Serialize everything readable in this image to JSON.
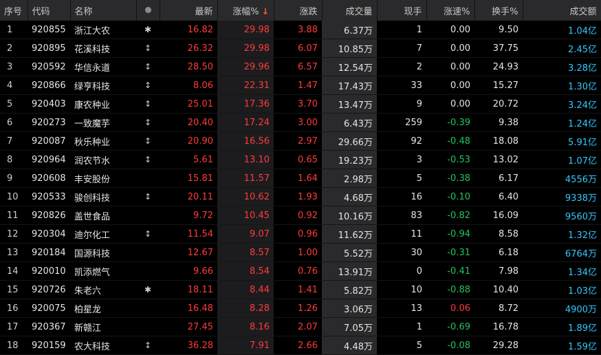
{
  "headers": {
    "seq": "序号",
    "code": "代码",
    "name": "名称",
    "flag": "",
    "latest": "最新",
    "change_pct": "涨幅%",
    "sort_arrow": "↓",
    "change": "涨跌",
    "volume": "成交量",
    "current": "现手",
    "speed": "涨速%",
    "turnover": "换手%",
    "amount": "成交额"
  },
  "colors": {
    "up": "#ff3b3b",
    "down": "#22c55e",
    "neutral": "#e6e6e6",
    "amount": "#33c9ff",
    "sort_arrow": "#ff5a1f"
  },
  "rows": [
    {
      "seq": "1",
      "code": "920855",
      "name": "浙江大农",
      "flag": "✱",
      "latest": "16.82",
      "change_pct": "29.98",
      "change": "3.88",
      "volume": "6.37万",
      "current": "1",
      "speed": "0.00",
      "speed_dir": "neutral",
      "turnover": "9.50",
      "amount": "1.04亿"
    },
    {
      "seq": "2",
      "code": "920895",
      "name": "花溪科技",
      "flag": "↕",
      "latest": "26.32",
      "change_pct": "29.98",
      "change": "6.07",
      "volume": "10.85万",
      "current": "7",
      "speed": "0.00",
      "speed_dir": "neutral",
      "turnover": "37.75",
      "amount": "2.45亿"
    },
    {
      "seq": "3",
      "code": "920592",
      "name": "华信永道",
      "flag": "↕",
      "latest": "28.50",
      "change_pct": "29.96",
      "change": "6.57",
      "volume": "12.54万",
      "current": "2",
      "speed": "0.00",
      "speed_dir": "neutral",
      "turnover": "24.93",
      "amount": "3.28亿"
    },
    {
      "seq": "4",
      "code": "920866",
      "name": "绿亨科技",
      "flag": "↕",
      "latest": "8.06",
      "change_pct": "22.31",
      "change": "1.47",
      "volume": "17.43万",
      "current": "33",
      "speed": "0.00",
      "speed_dir": "neutral",
      "turnover": "15.27",
      "amount": "1.30亿"
    },
    {
      "seq": "5",
      "code": "920403",
      "name": "康农种业",
      "flag": "↕",
      "latest": "25.01",
      "change_pct": "17.36",
      "change": "3.70",
      "volume": "13.47万",
      "current": "9",
      "speed": "0.00",
      "speed_dir": "neutral",
      "turnover": "20.72",
      "amount": "3.24亿"
    },
    {
      "seq": "6",
      "code": "920273",
      "name": "一致魔芋",
      "flag": "↕",
      "latest": "20.40",
      "change_pct": "17.24",
      "change": "3.00",
      "volume": "6.43万",
      "current": "259",
      "speed": "-0.39",
      "speed_dir": "down",
      "turnover": "9.38",
      "amount": "1.24亿"
    },
    {
      "seq": "7",
      "code": "920087",
      "name": "秋乐种业",
      "flag": "↕",
      "latest": "20.90",
      "change_pct": "16.56",
      "change": "2.97",
      "volume": "29.66万",
      "current": "92",
      "speed": "-0.48",
      "speed_dir": "down",
      "turnover": "18.08",
      "amount": "5.91亿"
    },
    {
      "seq": "8",
      "code": "920964",
      "name": "润农节水",
      "flag": "↕",
      "latest": "5.61",
      "change_pct": "13.10",
      "change": "0.65",
      "volume": "19.23万",
      "current": "3",
      "speed": "-0.53",
      "speed_dir": "down",
      "turnover": "13.02",
      "amount": "1.07亿"
    },
    {
      "seq": "9",
      "code": "920608",
      "name": "丰安股份",
      "flag": "",
      "latest": "15.81",
      "change_pct": "11.57",
      "change": "1.64",
      "volume": "2.98万",
      "current": "5",
      "speed": "-0.38",
      "speed_dir": "down",
      "turnover": "6.17",
      "amount": "4556万"
    },
    {
      "seq": "10",
      "code": "920533",
      "name": "骏创科技",
      "flag": "↕",
      "latest": "20.11",
      "change_pct": "10.62",
      "change": "1.93",
      "volume": "4.68万",
      "current": "16",
      "speed": "-0.10",
      "speed_dir": "down",
      "turnover": "6.40",
      "amount": "9338万"
    },
    {
      "seq": "11",
      "code": "920826",
      "name": "盖世食品",
      "flag": "",
      "latest": "9.72",
      "change_pct": "10.45",
      "change": "0.92",
      "volume": "10.16万",
      "current": "83",
      "speed": "-0.82",
      "speed_dir": "down",
      "turnover": "16.09",
      "amount": "9560万"
    },
    {
      "seq": "12",
      "code": "920304",
      "name": "迪尔化工",
      "flag": "↕",
      "latest": "11.54",
      "change_pct": "9.07",
      "change": "0.96",
      "volume": "11.62万",
      "current": "11",
      "speed": "-0.94",
      "speed_dir": "down",
      "turnover": "8.58",
      "amount": "1.32亿"
    },
    {
      "seq": "13",
      "code": "920184",
      "name": "国源科技",
      "flag": "",
      "latest": "12.67",
      "change_pct": "8.57",
      "change": "1.00",
      "volume": "5.52万",
      "current": "30",
      "speed": "-0.31",
      "speed_dir": "down",
      "turnover": "6.18",
      "amount": "6764万"
    },
    {
      "seq": "14",
      "code": "920010",
      "name": "凯添燃气",
      "flag": "",
      "latest": "9.66",
      "change_pct": "8.54",
      "change": "0.76",
      "volume": "13.91万",
      "current": "0",
      "speed": "-0.41",
      "speed_dir": "down",
      "turnover": "7.98",
      "amount": "1.34亿"
    },
    {
      "seq": "15",
      "code": "920726",
      "name": "朱老六",
      "flag": "✱",
      "latest": "18.11",
      "change_pct": "8.44",
      "change": "1.41",
      "volume": "5.82万",
      "current": "10",
      "speed": "-0.88",
      "speed_dir": "down",
      "turnover": "10.40",
      "amount": "1.03亿"
    },
    {
      "seq": "16",
      "code": "920075",
      "name": "柏星龙",
      "flag": "",
      "latest": "16.48",
      "change_pct": "8.28",
      "change": "1.26",
      "volume": "3.06万",
      "current": "13",
      "speed": "0.06",
      "speed_dir": "up",
      "turnover": "8.72",
      "amount": "4900万"
    },
    {
      "seq": "17",
      "code": "920367",
      "name": "新赣江",
      "flag": "",
      "latest": "27.45",
      "change_pct": "8.16",
      "change": "2.07",
      "volume": "7.05万",
      "current": "1",
      "speed": "-0.69",
      "speed_dir": "down",
      "turnover": "16.78",
      "amount": "1.89亿"
    },
    {
      "seq": "18",
      "code": "920159",
      "name": "农大科技",
      "flag": "↕",
      "latest": "36.28",
      "change_pct": "7.91",
      "change": "2.66",
      "volume": "4.48万",
      "current": "5",
      "speed": "-0.08",
      "speed_dir": "down",
      "turnover": "29.28",
      "amount": "1.59亿"
    }
  ]
}
